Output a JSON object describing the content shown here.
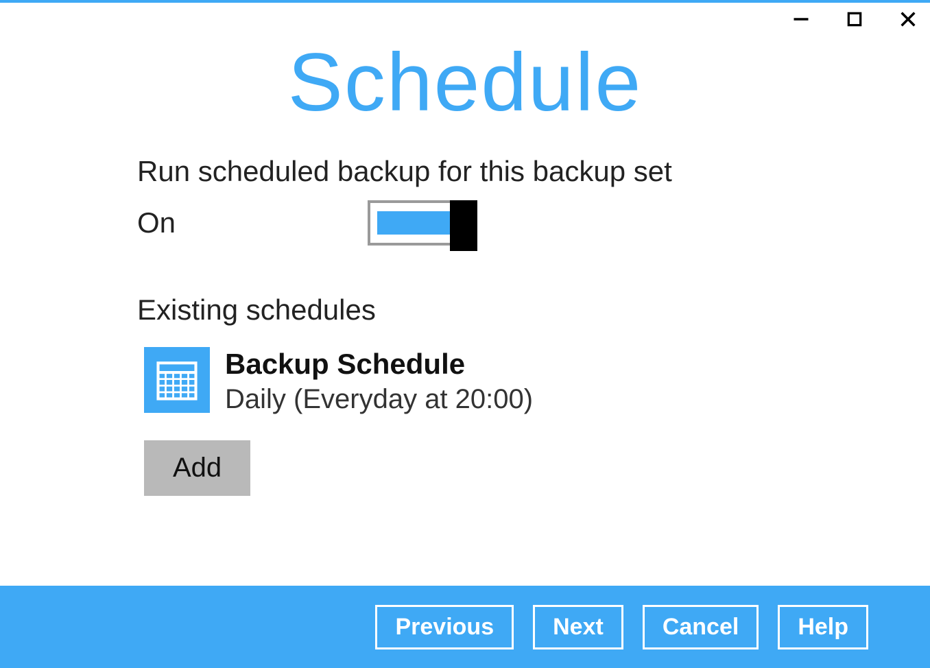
{
  "header": {
    "title": "Schedule"
  },
  "main": {
    "run_label": "Run scheduled backup for this backup set",
    "toggle_state_label": "On",
    "existing_label": "Existing schedules",
    "schedule": {
      "name": "Backup Schedule",
      "description": "Daily (Everyday at 20:00)"
    },
    "add_label": "Add"
  },
  "footer": {
    "previous": "Previous",
    "next": "Next",
    "cancel": "Cancel",
    "help": "Help"
  },
  "colors": {
    "accent": "#3fa9f5"
  }
}
